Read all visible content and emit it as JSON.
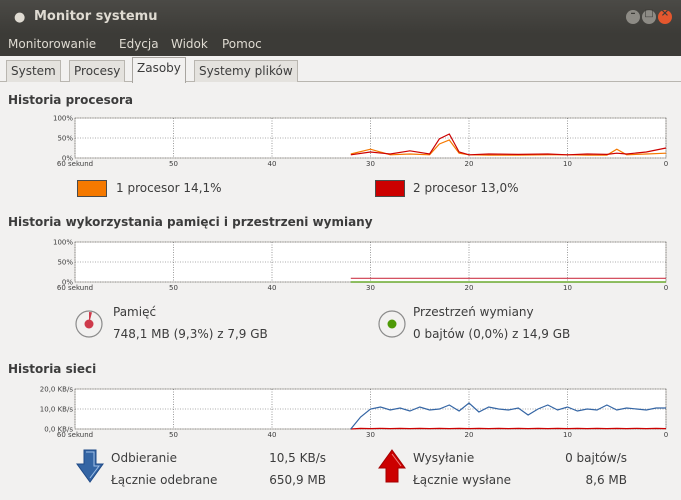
{
  "window": {
    "title": "Monitor systemu"
  },
  "menu": [
    "Monitorowanie",
    "Edycja",
    "Widok",
    "Pomoc"
  ],
  "tabs": [
    "System",
    "Procesy",
    "Zasoby",
    "Systemy plików"
  ],
  "active_tab": "Zasoby",
  "time_axis": [
    "60 sekund",
    "50",
    "40",
    "30",
    "20",
    "10",
    "0"
  ],
  "cpu": {
    "title": "Historia procesora",
    "yticks": [
      "100%",
      "50%",
      "0%"
    ],
    "cpu1": {
      "label": "1 procesor",
      "value": "14,1%",
      "color": "#f57900"
    },
    "cpu2": {
      "label": "2 procesor",
      "value": "13,0%",
      "color": "#cc0000"
    }
  },
  "memory": {
    "title": "Historia wykorzystania pamięci i przestrzeni wymiany",
    "yticks": [
      "100%",
      "50%",
      "0%"
    ],
    "ram": {
      "label": "Pamięć",
      "value": "748,1 MB (9,3%) z 7,9 GB",
      "color": "#ce3a4b",
      "fraction": 0.093
    },
    "swap": {
      "label": "Przestrzeń wymiany",
      "value": "0 bajtów (0,0%) z 14,9 GB",
      "color": "#4e9a06",
      "fraction": 0.0
    }
  },
  "network": {
    "title": "Historia sieci",
    "yticks": [
      "20,0 KB/s",
      "10,0 KB/s",
      "0,0 KB/s"
    ],
    "recv": {
      "label": "Odbieranie",
      "value": "10,5 KB/s",
      "total_label": "Łącznie odebrane",
      "total": "650,9 MB",
      "color": "#3465a4"
    },
    "send": {
      "label": "Wysyłanie",
      "value": "0 bajtów/s",
      "total_label": "Łącznie wysłane",
      "total": "8,6 MB",
      "color": "#cc0000"
    }
  },
  "chart_data": [
    {
      "type": "line",
      "title": "Historia procesora",
      "xlabel": "",
      "ylabel": "",
      "ylim": [
        0,
        100
      ],
      "x_reversed": true,
      "x": [
        32,
        30,
        28,
        26,
        24,
        23,
        22,
        21,
        20,
        18,
        15,
        12,
        10,
        8,
        6,
        5,
        4,
        2,
        0
      ],
      "series": [
        {
          "name": "1 procesor",
          "values": [
            10,
            22,
            8,
            10,
            8,
            35,
            45,
            12,
            8,
            7,
            7,
            8,
            8,
            7,
            7,
            22,
            8,
            10,
            12
          ]
        },
        {
          "name": "2 procesor",
          "values": [
            8,
            15,
            10,
            18,
            10,
            48,
            60,
            15,
            8,
            10,
            9,
            10,
            8,
            10,
            9,
            12,
            10,
            15,
            25
          ]
        }
      ]
    },
    {
      "type": "line",
      "title": "Historia wykorzystania pamięci i przestrzeni wymiany",
      "ylim": [
        0,
        100
      ],
      "x": [
        32,
        0
      ],
      "series": [
        {
          "name": "Pamięć",
          "values": [
            9.3,
            9.3
          ]
        },
        {
          "name": "Przestrzeń wymiany",
          "values": [
            0,
            0
          ]
        }
      ]
    },
    {
      "type": "line",
      "title": "Historia sieci",
      "ylim": [
        0,
        20
      ],
      "x": [
        32,
        31,
        30,
        29,
        28,
        27,
        26,
        25,
        24,
        23,
        22,
        21,
        20,
        19,
        18,
        17,
        16,
        15,
        14,
        13,
        12,
        11,
        10,
        9,
        8,
        7,
        6,
        5,
        4,
        3,
        2,
        1,
        0
      ],
      "series": [
        {
          "name": "Odbieranie",
          "values": [
            0,
            6,
            10,
            11,
            9.5,
            10.5,
            9,
            11,
            9.5,
            10,
            12,
            9,
            13,
            8.5,
            11,
            10,
            9.5,
            10.5,
            7,
            10,
            12,
            9.5,
            11,
            9,
            10,
            9.5,
            12,
            9.5,
            10.5,
            10,
            9.5,
            10.5,
            10.5
          ]
        },
        {
          "name": "Wysyłanie",
          "values": [
            0,
            0.3,
            0.2,
            0.3,
            0.2,
            0.3,
            0.2,
            0.3,
            0.2,
            0.3,
            0.2,
            0.3,
            0.2,
            0.3,
            0.2,
            0.3,
            0.2,
            0.3,
            0.2,
            0.3,
            0.2,
            0.3,
            0.2,
            0.3,
            0.2,
            0.3,
            0.2,
            0.3,
            0.2,
            0.3,
            0.2,
            0.3,
            0.2
          ]
        }
      ]
    }
  ]
}
